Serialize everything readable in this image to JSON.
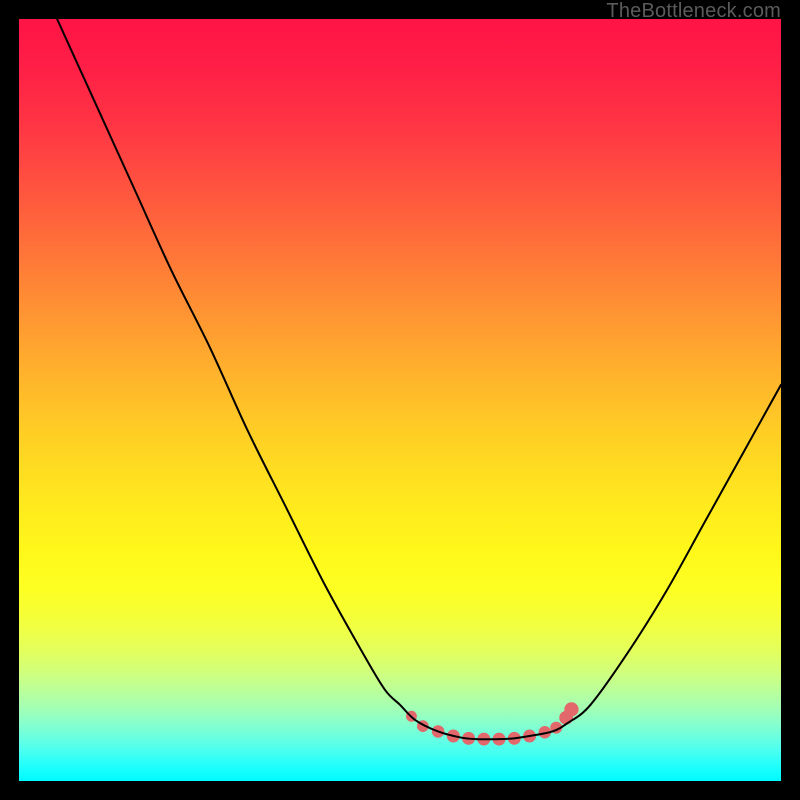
{
  "watermark": "TheBottleneck.com",
  "colors": {
    "black": "#000000",
    "curve": "#000000",
    "bead": "#e2686b"
  },
  "chart_data": {
    "type": "line",
    "title": "",
    "xlabel": "",
    "ylabel": "",
    "xlim": [
      0,
      100
    ],
    "ylim": [
      0,
      100
    ],
    "grid": false,
    "legend": false,
    "note": "V-shaped bottleneck curve on a rainbow gradient. Values estimated from pixel positions; y=0 is bottom (green), y=100 is top (red).",
    "series": [
      {
        "name": "bottleneck-curve",
        "x": [
          5,
          10,
          15,
          20,
          25,
          30,
          35,
          40,
          45,
          48,
          50,
          52,
          55,
          58,
          60,
          63,
          65,
          67,
          70,
          72,
          75,
          80,
          85,
          90,
          95,
          100
        ],
        "y": [
          100,
          89,
          78,
          67,
          57,
          46,
          36,
          26,
          17,
          12,
          10,
          8,
          6.5,
          5.7,
          5.5,
          5.5,
          5.6,
          5.9,
          6.5,
          7.6,
          10,
          17,
          25,
          34,
          43,
          52
        ]
      }
    ],
    "beads": {
      "name": "highlight-beads",
      "note": "Soft pink dots near the valley of the curve",
      "x": [
        51.5,
        53,
        55,
        57,
        59,
        61,
        63,
        65,
        67,
        69,
        70.5,
        71.8,
        72.5
      ],
      "y": [
        8.5,
        7.2,
        6.5,
        5.9,
        5.6,
        5.5,
        5.5,
        5.6,
        5.9,
        6.4,
        7.0,
        8.3,
        9.4
      ],
      "r": [
        4.2,
        4.5,
        4.8,
        5.0,
        5.0,
        5.0,
        5.0,
        5.0,
        5.0,
        4.8,
        4.6,
        5.3,
        5.5
      ]
    }
  }
}
